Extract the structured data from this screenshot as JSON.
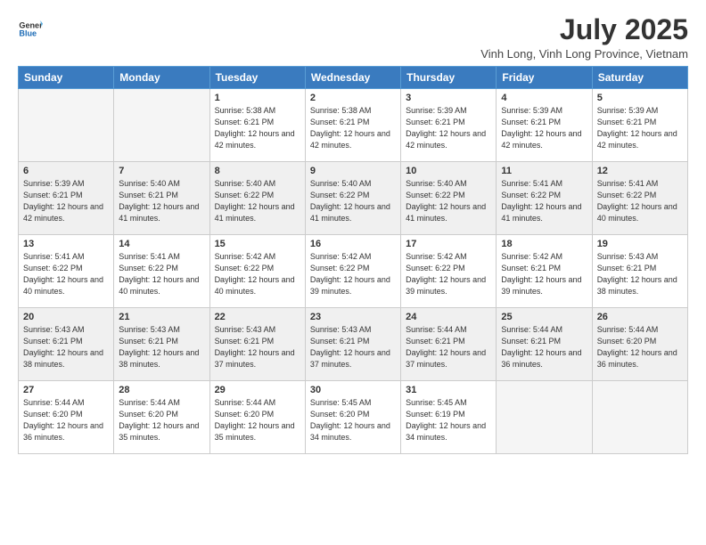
{
  "header": {
    "logo_general": "General",
    "logo_blue": "Blue",
    "month_year": "July 2025",
    "location": "Vinh Long, Vinh Long Province, Vietnam"
  },
  "weekdays": [
    "Sunday",
    "Monday",
    "Tuesday",
    "Wednesday",
    "Thursday",
    "Friday",
    "Saturday"
  ],
  "weeks": [
    [
      {
        "day": "",
        "empty": true
      },
      {
        "day": "",
        "empty": true
      },
      {
        "day": "1",
        "sunrise": "5:38 AM",
        "sunset": "6:21 PM",
        "daylight": "12 hours and 42 minutes."
      },
      {
        "day": "2",
        "sunrise": "5:38 AM",
        "sunset": "6:21 PM",
        "daylight": "12 hours and 42 minutes."
      },
      {
        "day": "3",
        "sunrise": "5:39 AM",
        "sunset": "6:21 PM",
        "daylight": "12 hours and 42 minutes."
      },
      {
        "day": "4",
        "sunrise": "5:39 AM",
        "sunset": "6:21 PM",
        "daylight": "12 hours and 42 minutes."
      },
      {
        "day": "5",
        "sunrise": "5:39 AM",
        "sunset": "6:21 PM",
        "daylight": "12 hours and 42 minutes."
      }
    ],
    [
      {
        "day": "6",
        "sunrise": "5:39 AM",
        "sunset": "6:21 PM",
        "daylight": "12 hours and 42 minutes."
      },
      {
        "day": "7",
        "sunrise": "5:40 AM",
        "sunset": "6:21 PM",
        "daylight": "12 hours and 41 minutes."
      },
      {
        "day": "8",
        "sunrise": "5:40 AM",
        "sunset": "6:22 PM",
        "daylight": "12 hours and 41 minutes."
      },
      {
        "day": "9",
        "sunrise": "5:40 AM",
        "sunset": "6:22 PM",
        "daylight": "12 hours and 41 minutes."
      },
      {
        "day": "10",
        "sunrise": "5:40 AM",
        "sunset": "6:22 PM",
        "daylight": "12 hours and 41 minutes."
      },
      {
        "day": "11",
        "sunrise": "5:41 AM",
        "sunset": "6:22 PM",
        "daylight": "12 hours and 41 minutes."
      },
      {
        "day": "12",
        "sunrise": "5:41 AM",
        "sunset": "6:22 PM",
        "daylight": "12 hours and 40 minutes."
      }
    ],
    [
      {
        "day": "13",
        "sunrise": "5:41 AM",
        "sunset": "6:22 PM",
        "daylight": "12 hours and 40 minutes."
      },
      {
        "day": "14",
        "sunrise": "5:41 AM",
        "sunset": "6:22 PM",
        "daylight": "12 hours and 40 minutes."
      },
      {
        "day": "15",
        "sunrise": "5:42 AM",
        "sunset": "6:22 PM",
        "daylight": "12 hours and 40 minutes."
      },
      {
        "day": "16",
        "sunrise": "5:42 AM",
        "sunset": "6:22 PM",
        "daylight": "12 hours and 39 minutes."
      },
      {
        "day": "17",
        "sunrise": "5:42 AM",
        "sunset": "6:22 PM",
        "daylight": "12 hours and 39 minutes."
      },
      {
        "day": "18",
        "sunrise": "5:42 AM",
        "sunset": "6:21 PM",
        "daylight": "12 hours and 39 minutes."
      },
      {
        "day": "19",
        "sunrise": "5:43 AM",
        "sunset": "6:21 PM",
        "daylight": "12 hours and 38 minutes."
      }
    ],
    [
      {
        "day": "20",
        "sunrise": "5:43 AM",
        "sunset": "6:21 PM",
        "daylight": "12 hours and 38 minutes."
      },
      {
        "day": "21",
        "sunrise": "5:43 AM",
        "sunset": "6:21 PM",
        "daylight": "12 hours and 38 minutes."
      },
      {
        "day": "22",
        "sunrise": "5:43 AM",
        "sunset": "6:21 PM",
        "daylight": "12 hours and 37 minutes."
      },
      {
        "day": "23",
        "sunrise": "5:43 AM",
        "sunset": "6:21 PM",
        "daylight": "12 hours and 37 minutes."
      },
      {
        "day": "24",
        "sunrise": "5:44 AM",
        "sunset": "6:21 PM",
        "daylight": "12 hours and 37 minutes."
      },
      {
        "day": "25",
        "sunrise": "5:44 AM",
        "sunset": "6:21 PM",
        "daylight": "12 hours and 36 minutes."
      },
      {
        "day": "26",
        "sunrise": "5:44 AM",
        "sunset": "6:20 PM",
        "daylight": "12 hours and 36 minutes."
      }
    ],
    [
      {
        "day": "27",
        "sunrise": "5:44 AM",
        "sunset": "6:20 PM",
        "daylight": "12 hours and 36 minutes."
      },
      {
        "day": "28",
        "sunrise": "5:44 AM",
        "sunset": "6:20 PM",
        "daylight": "12 hours and 35 minutes."
      },
      {
        "day": "29",
        "sunrise": "5:44 AM",
        "sunset": "6:20 PM",
        "daylight": "12 hours and 35 minutes."
      },
      {
        "day": "30",
        "sunrise": "5:45 AM",
        "sunset": "6:20 PM",
        "daylight": "12 hours and 34 minutes."
      },
      {
        "day": "31",
        "sunrise": "5:45 AM",
        "sunset": "6:19 PM",
        "daylight": "12 hours and 34 minutes."
      },
      {
        "day": "",
        "empty": true
      },
      {
        "day": "",
        "empty": true
      }
    ]
  ]
}
